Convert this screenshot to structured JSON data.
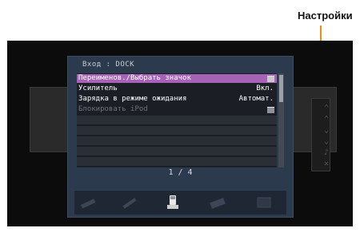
{
  "callout": {
    "label": "Настройки"
  },
  "panel": {
    "title": "Вход : DOCK",
    "page_indicator": "1 / 4",
    "items": [
      {
        "label": "Переименов./Выбрать значок",
        "value": "",
        "icon": "folder-icon"
      },
      {
        "label": "Усилитель",
        "value": "Вкл.",
        "icon": ""
      },
      {
        "label": "Зарядка в режиме ожидания",
        "value": "Автомат.",
        "icon": ""
      },
      {
        "label": "Блокировать iPod",
        "value": "",
        "icon": "folder-icon"
      }
    ]
  },
  "colors": {
    "selected": "#a562b6",
    "callout": "#e8901a",
    "panel_bg": "#2c3a4e"
  },
  "dock_icons": [
    "cable-icon",
    "cable-icon",
    "ipod-dock-icon",
    "keyboard-icon",
    "device-icon"
  ]
}
